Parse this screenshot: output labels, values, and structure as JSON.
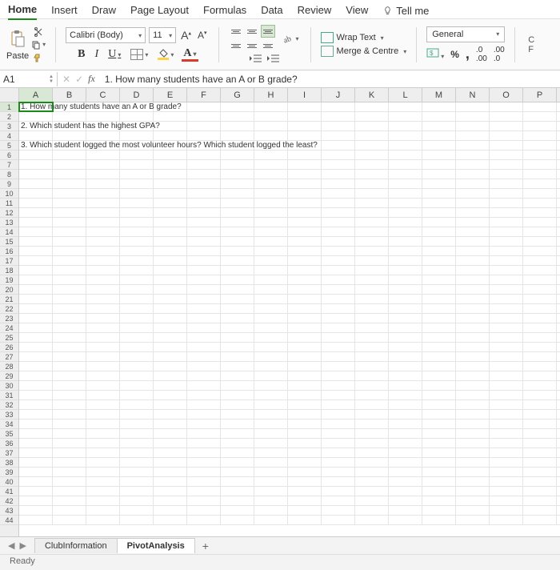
{
  "menu": {
    "tabs": [
      "Home",
      "Insert",
      "Draw",
      "Page Layout",
      "Formulas",
      "Data",
      "Review",
      "View"
    ],
    "active": "Home",
    "tellme": "Tell me"
  },
  "ribbon": {
    "paste": "Paste",
    "font_name": "Calibri (Body)",
    "font_size": "11",
    "wrap": "Wrap Text",
    "merge": "Merge & Centre",
    "number_format": "General",
    "percent": "%",
    "comma": ","
  },
  "formula_bar": {
    "cell_ref": "A1",
    "fx": "fx",
    "value": "1. How many students have an A or B grade?"
  },
  "columns": [
    "A",
    "B",
    "C",
    "D",
    "E",
    "F",
    "G",
    "H",
    "I",
    "J",
    "K",
    "L",
    "M",
    "N",
    "O",
    "P"
  ],
  "row_count": 44,
  "cell_data": {
    "1": "1. How many students have an A or B grade?",
    "3": "2. Which student has the highest GPA?",
    "5": "3. Which student logged the most volunteer hours? Which student logged the least?"
  },
  "sheets": {
    "tabs": [
      "ClubInformation",
      "PivotAnalysis"
    ],
    "active": "PivotAnalysis"
  },
  "status": "Ready"
}
